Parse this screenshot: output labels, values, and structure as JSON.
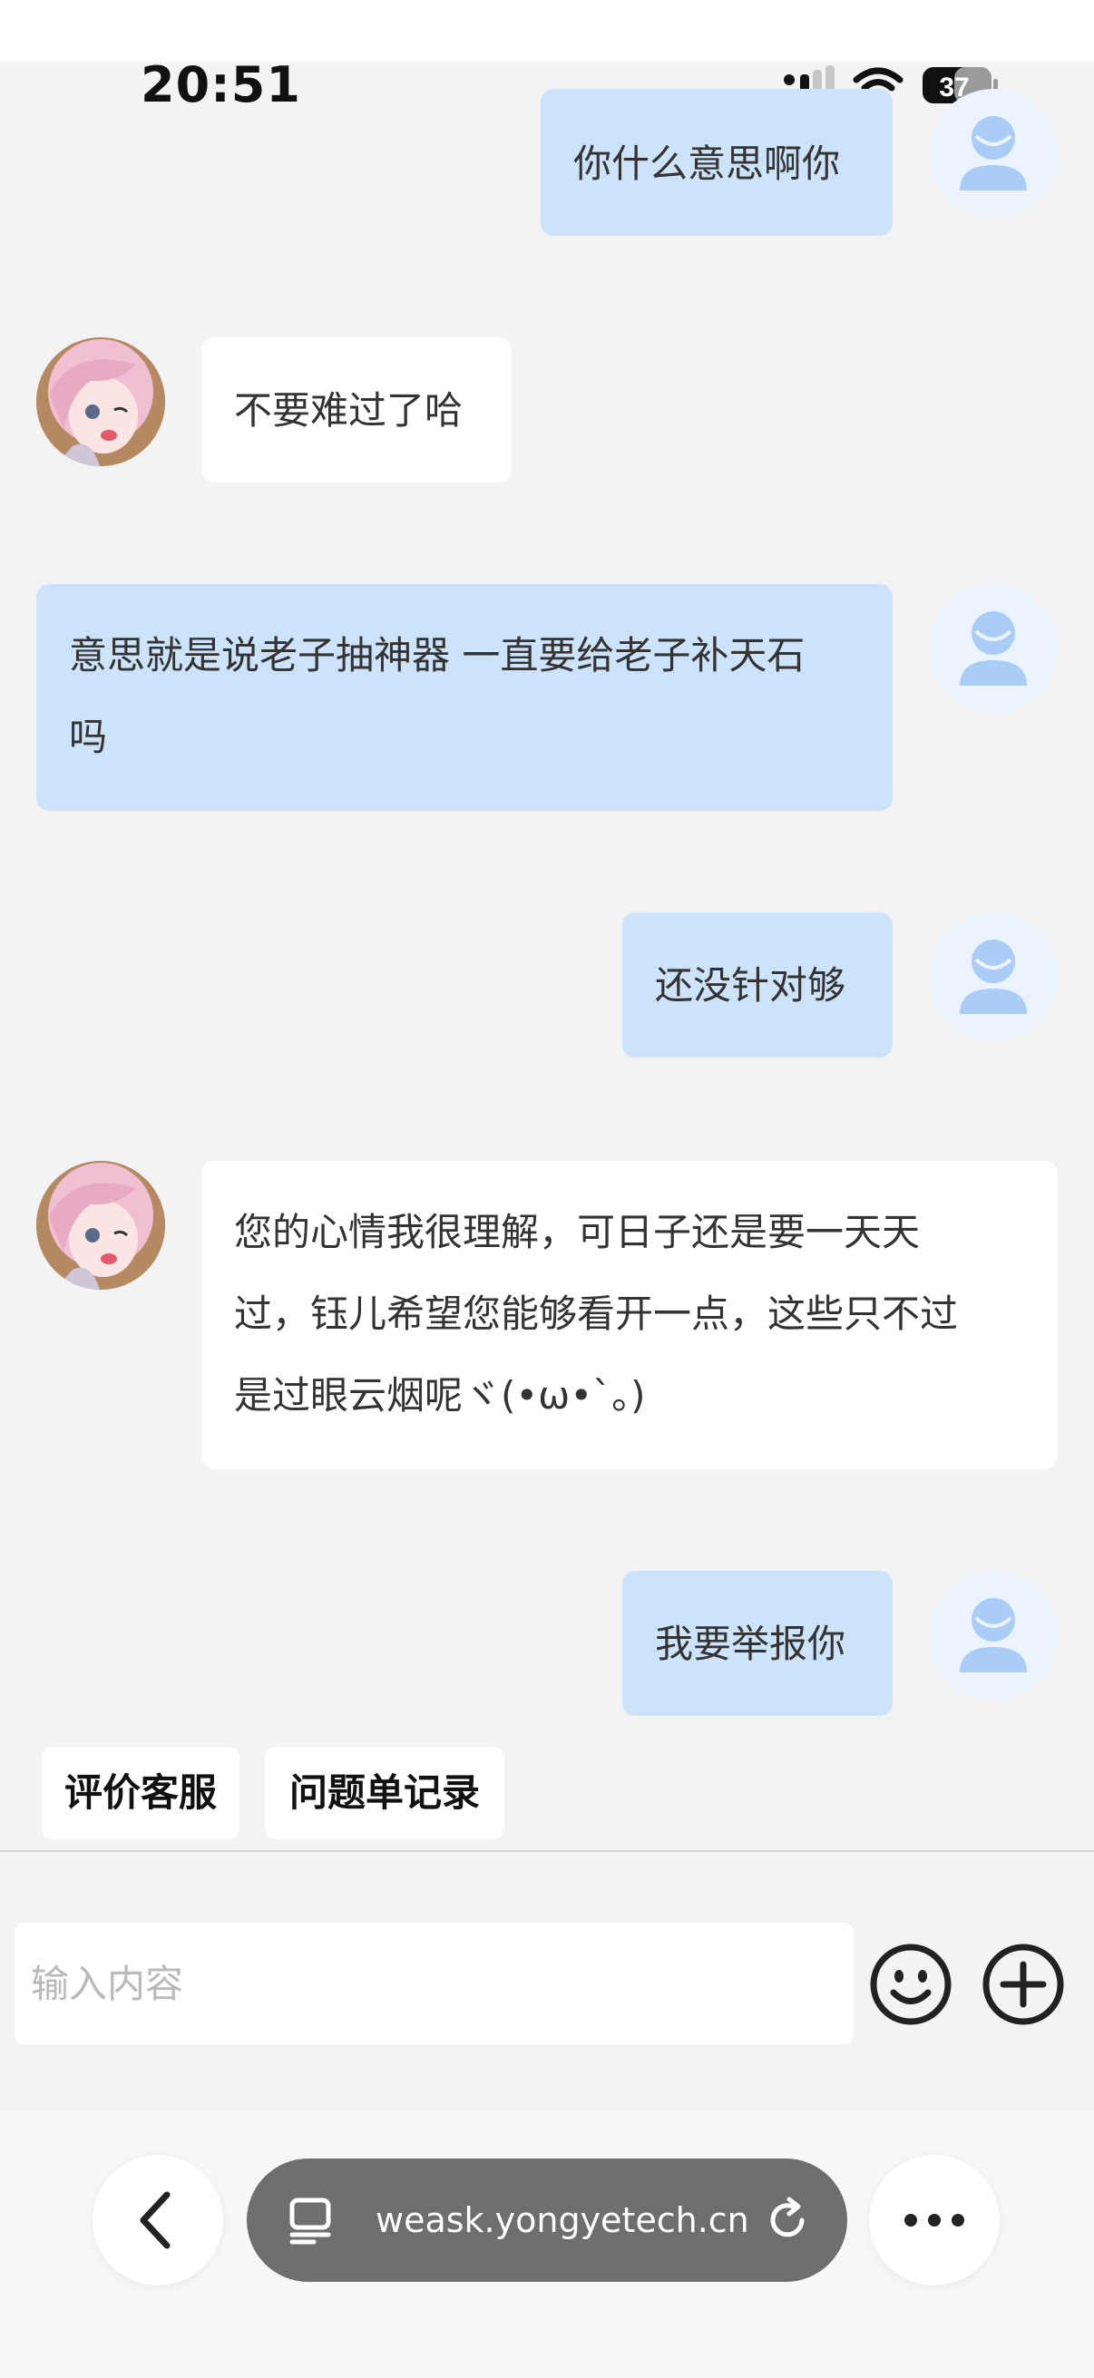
{
  "status_bar": {
    "time": "20:51",
    "battery": "37"
  },
  "messages": [
    {
      "role": "user",
      "text": "你什么意思啊你"
    },
    {
      "role": "agent",
      "text": "不要难过了哈"
    },
    {
      "role": "user",
      "lines": [
        "意思就是说老子抽神器 一直要给老子补天石",
        "吗"
      ]
    },
    {
      "role": "user",
      "text": "还没针对够"
    },
    {
      "role": "agent",
      "lines": [
        "您的心情我很理解，可日子还是要一天天",
        "过，钰儿希望您能够看开一点，这些只不过",
        "是过眼云烟呢ヾ(•ω•`。)"
      ]
    },
    {
      "role": "user",
      "text": "我要举报你"
    }
  ],
  "quick_actions": [
    "评价客服",
    "问题单记录"
  ],
  "composer": {
    "placeholder": "输入内容",
    "value": "",
    "emoji_icon": "smiley-icon",
    "add_icon": "plus-circle-icon"
  },
  "browser": {
    "url": "weask.yongyetech.cn",
    "back_icon": "chevron-left-icon",
    "tabs_icon": "tabs-icon",
    "reload_icon": "reload-icon",
    "more_icon": "more-icon"
  },
  "colors": {
    "user_bubble": "#cde3fa",
    "agent_bubble": "#ffffff",
    "background": "#f3f3f3",
    "user_avatar": "#a9cdf6"
  }
}
